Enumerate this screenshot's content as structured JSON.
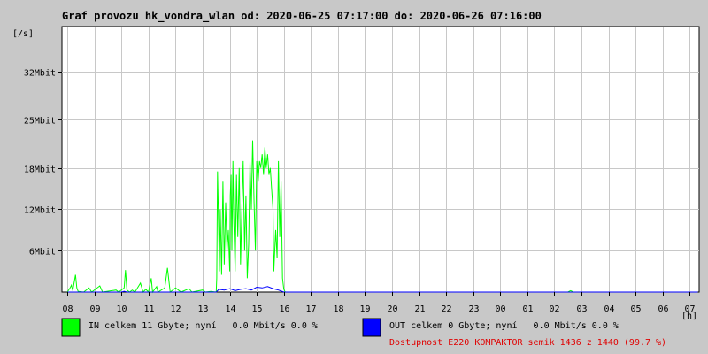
{
  "chart_data": {
    "type": "line",
    "title": "Graf provozu hk_vondra_wlan od: 2020-06-25 07:17:00 do: 2020-06-26 07:16:00",
    "ylabel": "[/s]",
    "xlabel": "[h]",
    "ylim": [
      0,
      38.5
    ],
    "xlim": [
      7.8,
      31.35
    ],
    "y_ticks": [
      {
        "value": 6,
        "label": "6Mbit"
      },
      {
        "value": 12,
        "label": "12Mbit"
      },
      {
        "value": 18,
        "label": "18Mbit"
      },
      {
        "value": 25,
        "label": "25Mbit"
      },
      {
        "value": 32,
        "label": "32Mbit"
      }
    ],
    "x_ticks": [
      {
        "value": 8,
        "label": "08"
      },
      {
        "value": 9,
        "label": "09"
      },
      {
        "value": 10,
        "label": "10"
      },
      {
        "value": 11,
        "label": "11"
      },
      {
        "value": 12,
        "label": "12"
      },
      {
        "value": 13,
        "label": "13"
      },
      {
        "value": 14,
        "label": "14"
      },
      {
        "value": 15,
        "label": "15"
      },
      {
        "value": 16,
        "label": "16"
      },
      {
        "value": 17,
        "label": "17"
      },
      {
        "value": 18,
        "label": "18"
      },
      {
        "value": 19,
        "label": "19"
      },
      {
        "value": 20,
        "label": "20"
      },
      {
        "value": 21,
        "label": "21"
      },
      {
        "value": 22,
        "label": "22"
      },
      {
        "value": 23,
        "label": "23"
      },
      {
        "value": 24,
        "label": "00"
      },
      {
        "value": 25,
        "label": "01"
      },
      {
        "value": 26,
        "label": "02"
      },
      {
        "value": 27,
        "label": "03"
      },
      {
        "value": 28,
        "label": "04"
      },
      {
        "value": 29,
        "label": "05"
      },
      {
        "value": 30,
        "label": "06"
      },
      {
        "value": 31,
        "label": "07"
      }
    ],
    "grid": true,
    "series": [
      {
        "name": "IN",
        "color": "#00ff00",
        "points": [
          [
            8.0,
            0
          ],
          [
            8.1,
            0.6
          ],
          [
            8.15,
            1.0
          ],
          [
            8.2,
            0.2
          ],
          [
            8.3,
            2.5
          ],
          [
            8.35,
            0.6
          ],
          [
            8.4,
            0.1
          ],
          [
            8.6,
            0
          ],
          [
            8.8,
            0.6
          ],
          [
            8.9,
            0
          ],
          [
            9.2,
            0.9
          ],
          [
            9.3,
            0
          ],
          [
            9.8,
            0.3
          ],
          [
            9.9,
            0
          ],
          [
            10.1,
            0.6
          ],
          [
            10.15,
            3.2
          ],
          [
            10.2,
            0.3
          ],
          [
            10.3,
            0
          ],
          [
            10.4,
            0.3
          ],
          [
            10.5,
            0
          ],
          [
            10.7,
            1.3
          ],
          [
            10.8,
            0
          ],
          [
            10.9,
            0.4
          ],
          [
            11.0,
            0
          ],
          [
            11.1,
            2.0
          ],
          [
            11.15,
            0
          ],
          [
            11.3,
            0.8
          ],
          [
            11.35,
            0
          ],
          [
            11.6,
            0.6
          ],
          [
            11.7,
            3.5
          ],
          [
            11.8,
            0
          ],
          [
            12.0,
            0.6
          ],
          [
            12.2,
            0
          ],
          [
            12.5,
            0.5
          ],
          [
            12.6,
            0
          ],
          [
            13.0,
            0.3
          ],
          [
            13.1,
            0
          ],
          [
            13.3,
            0.1
          ],
          [
            13.5,
            0
          ],
          [
            13.52,
            2
          ],
          [
            13.55,
            17.5
          ],
          [
            13.6,
            8
          ],
          [
            13.62,
            3
          ],
          [
            13.65,
            12
          ],
          [
            13.7,
            2.5
          ],
          [
            13.75,
            16
          ],
          [
            13.8,
            4
          ],
          [
            13.85,
            13
          ],
          [
            13.9,
            6
          ],
          [
            13.95,
            9
          ],
          [
            14.0,
            3
          ],
          [
            14.02,
            14
          ],
          [
            14.05,
            17
          ],
          [
            14.08,
            6
          ],
          [
            14.12,
            19
          ],
          [
            14.15,
            11
          ],
          [
            14.2,
            3
          ],
          [
            14.25,
            17
          ],
          [
            14.3,
            8
          ],
          [
            14.35,
            18
          ],
          [
            14.4,
            4
          ],
          [
            14.45,
            12
          ],
          [
            14.5,
            19
          ],
          [
            14.55,
            6
          ],
          [
            14.6,
            14
          ],
          [
            14.65,
            2
          ],
          [
            14.7,
            7
          ],
          [
            14.75,
            19
          ],
          [
            14.8,
            12
          ],
          [
            14.85,
            22
          ],
          [
            14.9,
            13
          ],
          [
            14.95,
            6
          ],
          [
            15.0,
            19
          ],
          [
            15.05,
            16
          ],
          [
            15.1,
            19
          ],
          [
            15.15,
            18
          ],
          [
            15.2,
            20
          ],
          [
            15.25,
            17
          ],
          [
            15.3,
            21
          ],
          [
            15.35,
            18
          ],
          [
            15.4,
            20
          ],
          [
            15.45,
            17
          ],
          [
            15.5,
            18
          ],
          [
            15.55,
            15
          ],
          [
            15.6,
            12
          ],
          [
            15.63,
            3
          ],
          [
            15.7,
            9
          ],
          [
            15.75,
            5
          ],
          [
            15.8,
            19
          ],
          [
            15.85,
            8
          ],
          [
            15.9,
            16
          ],
          [
            15.95,
            2
          ],
          [
            16.0,
            0.4
          ],
          [
            16.05,
            0
          ],
          [
            26.5,
            0
          ],
          [
            26.6,
            0.2
          ],
          [
            26.7,
            0
          ],
          [
            31.3,
            0
          ]
        ]
      },
      {
        "name": "OUT",
        "color": "#0000ff",
        "points": [
          [
            8.0,
            0
          ],
          [
            10.0,
            0
          ],
          [
            10.1,
            0.1
          ],
          [
            10.2,
            0
          ],
          [
            13.5,
            0
          ],
          [
            13.6,
            0.4
          ],
          [
            13.8,
            0.3
          ],
          [
            14.0,
            0.5
          ],
          [
            14.2,
            0.2
          ],
          [
            14.4,
            0.4
          ],
          [
            14.6,
            0.5
          ],
          [
            14.8,
            0.3
          ],
          [
            15.0,
            0.7
          ],
          [
            15.2,
            0.6
          ],
          [
            15.4,
            0.8
          ],
          [
            15.6,
            0.5
          ],
          [
            15.8,
            0.3
          ],
          [
            16.0,
            0
          ],
          [
            31.3,
            0
          ]
        ]
      }
    ],
    "legend": [
      {
        "series": "IN",
        "color": "#00ff00",
        "text": "IN celkem 11 Gbyte; nyní   0.0 Mbit/s 0.0 %"
      },
      {
        "series": "OUT",
        "color": "#0000ff",
        "text": "OUT celkem 0 Gbyte; nyní   0.0 Mbit/s 0.0 %"
      }
    ],
    "availability": "Dostupnost E220 KOMPAKTOR semik 1436 z 1440 (99.7 %)"
  }
}
